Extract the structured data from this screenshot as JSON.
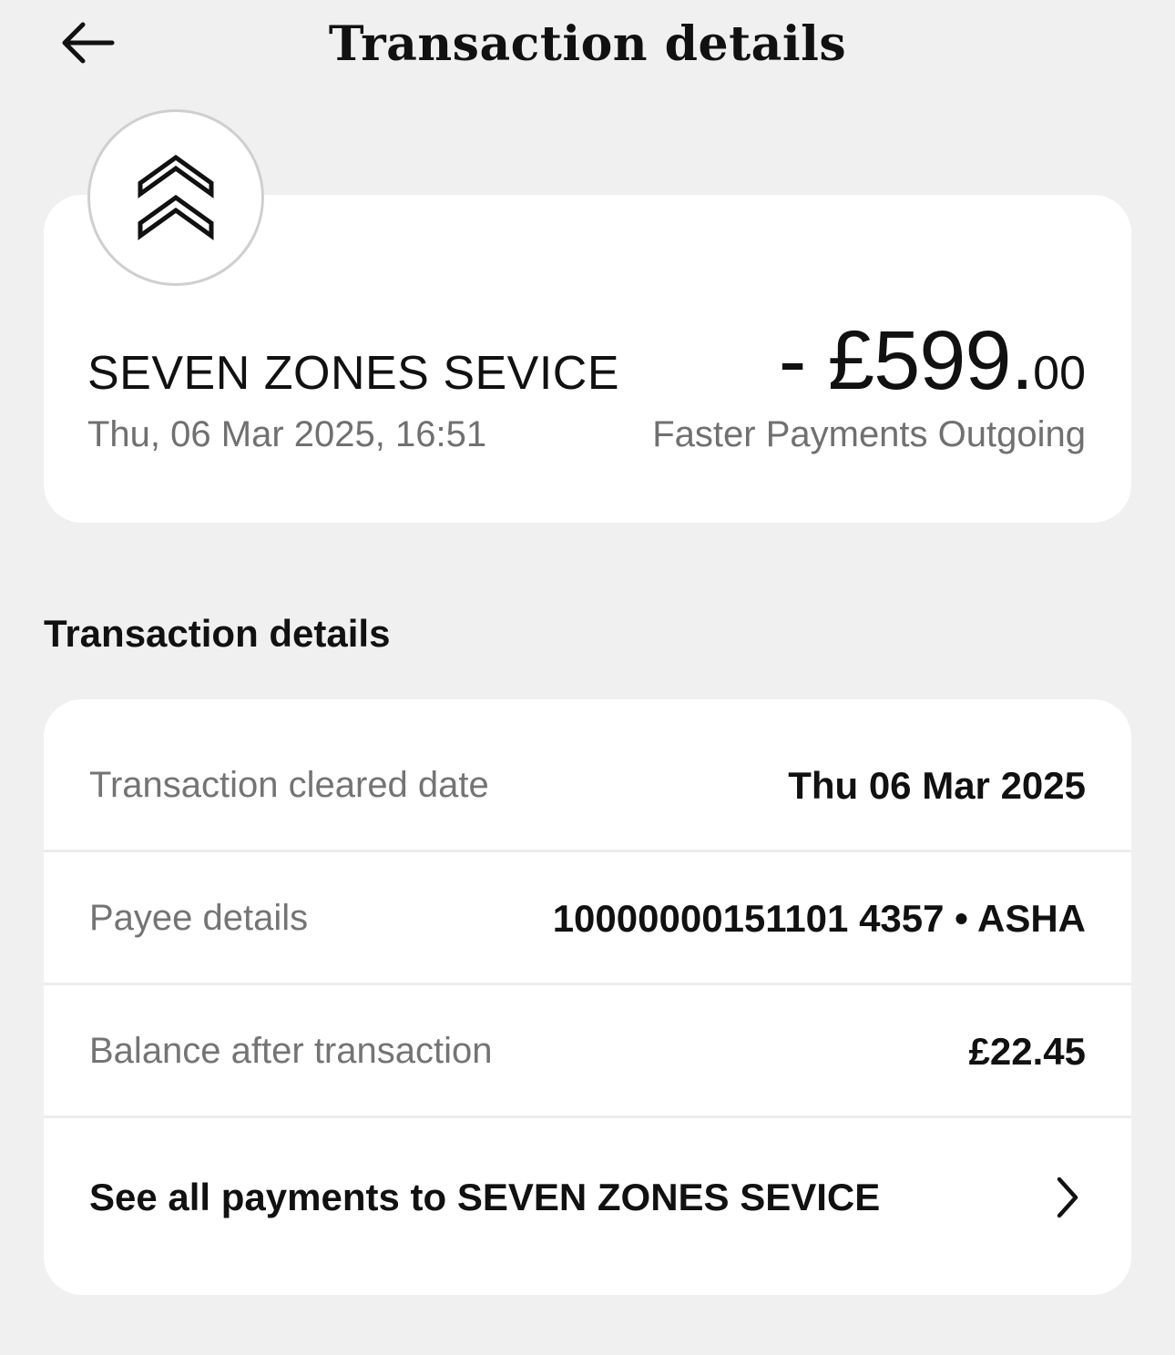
{
  "header": {
    "title": "Transaction details",
    "back_icon": "arrow-left-icon"
  },
  "summary": {
    "merchant_icon": "double-chevron-up-icon",
    "merchant_name": "SEVEN ZONES SEVICE",
    "datetime": "Thu, 06 Mar 2025, 16:51",
    "amount_main": "- £599.",
    "amount_minor": "00",
    "payment_type": "Faster Payments Outgoing"
  },
  "details": {
    "heading": "Transaction details",
    "rows": [
      {
        "label": "Transaction cleared date",
        "value": "Thu 06 Mar 2025"
      },
      {
        "label": "Payee details",
        "value": "10000000151101 4357 • ASHA"
      },
      {
        "label": "Balance after transaction",
        "value": "£22.45"
      }
    ],
    "see_all": {
      "label": "See all payments to SEVEN ZONES SEVICE",
      "icon": "chevron-right-icon"
    }
  },
  "colors": {
    "background": "#f0f0f0",
    "card": "#ffffff",
    "primary_text": "#111111",
    "secondary_text": "#707070",
    "divider": "#ececec"
  }
}
